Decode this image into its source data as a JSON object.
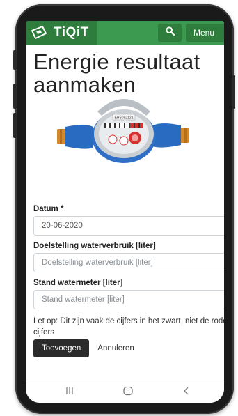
{
  "brand": {
    "name": "TiQiT"
  },
  "nav": {
    "search_icon": "search-icon",
    "menu_label": "Menu"
  },
  "page": {
    "title": "Energie resultaat aanmaken"
  },
  "image": {
    "meter_serial": "EHS092121"
  },
  "form": {
    "date": {
      "label": "Datum *",
      "value": "20-06-2020"
    },
    "target": {
      "label": "Doelstelling waterverbruik [liter]",
      "placeholder": "Doelstelling waterverbruik [liter]"
    },
    "reading": {
      "label": "Stand watermeter [liter]",
      "placeholder": "Stand watermeter [liter]"
    },
    "hint": "Let op: Dit zijn vaak de cijfers in het zwart, niet de rode cijfers",
    "submit_label": "Toevoegen",
    "cancel_label": "Annuleren"
  },
  "system_nav": {
    "recents_icon": "recents-icon",
    "home_icon": "home-icon",
    "back_icon": "back-icon"
  },
  "colors": {
    "brand_green": "#3b9a4f",
    "brand_green_dark": "#2e7d3d",
    "primary_button": "#2b2b2b"
  }
}
